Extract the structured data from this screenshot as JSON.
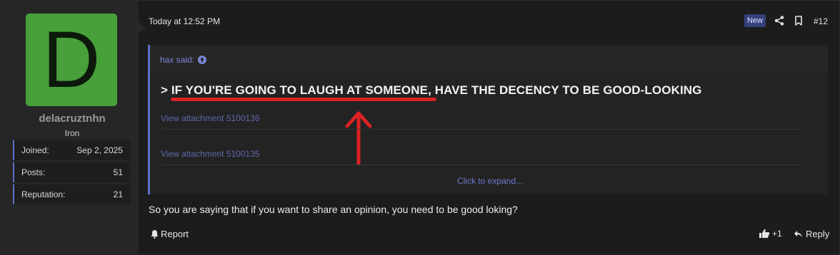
{
  "user": {
    "avatar_letter": "D",
    "avatar_color": "#47a03a",
    "username": "delacruztnhn",
    "title": "Iron",
    "stats": [
      {
        "label": "Joined:",
        "value": "Sep 2, 2025"
      },
      {
        "label": "Posts:",
        "value": "51"
      },
      {
        "label": "Reputation:",
        "value": "21"
      }
    ]
  },
  "header": {
    "date": "Today at 12:52 PM",
    "new_badge": "New",
    "post_number": "#12",
    "icons": [
      "share-icon",
      "bookmark-icon"
    ]
  },
  "quote": {
    "author": "hax said:",
    "author_icon": "arrow-up-circle-icon",
    "text": "> IF YOU'RE GOING TO LAUGH AT SOMEONE, HAVE THE DECENCY TO BE GOOD-LOOKING",
    "attachments": [
      "View attachment 5100136",
      "View attachment 5100135"
    ],
    "expand_label": "Click to expand..."
  },
  "body": {
    "text": "So you are saying that if you want to share an opinion, you need to be good loking?"
  },
  "footer": {
    "report_label": "Report",
    "like_count": "+1",
    "reply_label": "Reply"
  },
  "colors": {
    "accent": "#5c6fc5",
    "annotation_red": "#d92323",
    "link": "#7b86d6"
  }
}
